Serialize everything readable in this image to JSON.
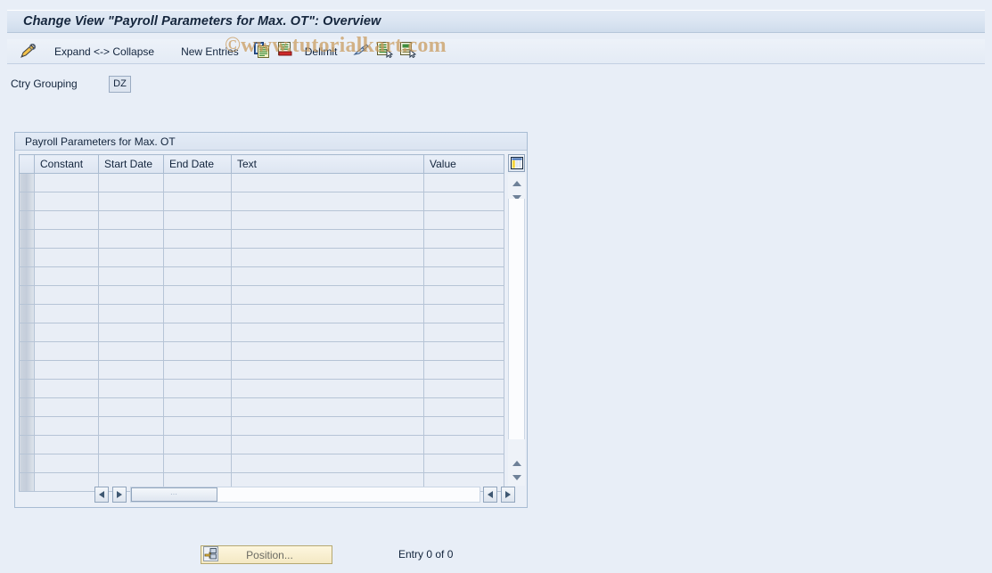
{
  "window": {
    "title": "Change View \"Payroll Parameters for Max. OT\": Overview"
  },
  "watermark": {
    "text": "©www.tutorialkart.com",
    "color": "#c99a5b"
  },
  "toolbar": {
    "items": [
      {
        "name": "display-change-icon",
        "label": "",
        "icon": "pencil-icon"
      },
      {
        "name": "expand-collapse-button",
        "label": "Expand <-> Collapse",
        "icon": ""
      },
      {
        "name": "new-entries-button",
        "label": "New Entries",
        "icon": ""
      },
      {
        "name": "copy-as-button",
        "label": "",
        "icon": "copy-icon"
      },
      {
        "name": "delete-button",
        "label": "",
        "icon": "delete-row-icon"
      },
      {
        "name": "delimit-button",
        "label": "Delimit",
        "icon": ""
      },
      {
        "name": "undo-button",
        "label": "",
        "icon": "undo-arrow-icon"
      },
      {
        "name": "select-all-button",
        "label": "",
        "icon": "select-block-icon"
      },
      {
        "name": "deselect-all-button",
        "label": "",
        "icon": "deselect-block-icon"
      }
    ],
    "expand_collapse_label": "Expand <-> Collapse",
    "new_entries_label": "New Entries",
    "delimit_label": "Delimit"
  },
  "selection": {
    "ctry_grouping_label": "Ctry Grouping",
    "ctry_grouping_value": "DZ"
  },
  "table": {
    "title": "Payroll Parameters for Max. OT",
    "columns": [
      {
        "key": "constant",
        "label": "Constant"
      },
      {
        "key": "start_date",
        "label": "Start Date"
      },
      {
        "key": "end_date",
        "label": "End Date"
      },
      {
        "key": "text",
        "label": "Text"
      },
      {
        "key": "value",
        "label": "Value"
      }
    ],
    "rows": [],
    "empty_row_count": 17,
    "settings_icon": "table-settings-icon"
  },
  "scrollbars": {
    "vertical": {
      "up_icon": "arrow-up-icon",
      "down_icon": "arrow-down-icon"
    },
    "horizontal": {
      "left_icon": "arrow-left-icon",
      "right_icon": "arrow-right-icon",
      "thumb_grip": "⋯"
    }
  },
  "footer": {
    "position_button_label": "Position...",
    "position_button_icon": "position-icon",
    "entry_status": "Entry 0 of 0"
  },
  "colors": {
    "background": "#e8eef7",
    "title_text": "#15263d",
    "grid_cell": "#e9eef6",
    "button_yellow": "#f4e9c4"
  }
}
